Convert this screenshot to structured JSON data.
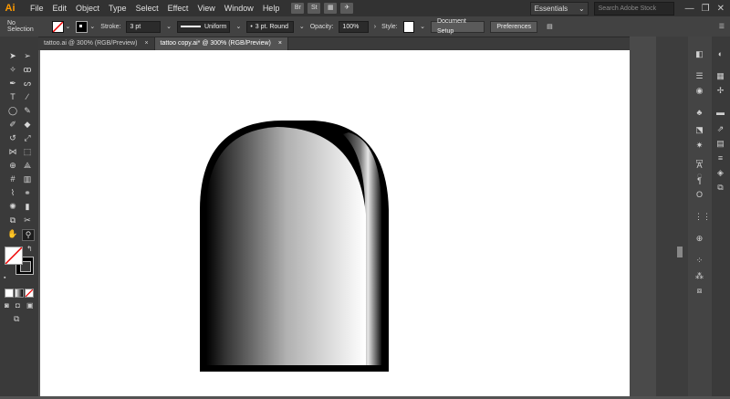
{
  "app": {
    "logo": "Ai"
  },
  "menu": [
    "File",
    "Edit",
    "Object",
    "Type",
    "Select",
    "Effect",
    "View",
    "Window",
    "Help"
  ],
  "app_icons": [
    "Br",
    "St"
  ],
  "workspace": "Essentials",
  "search_placeholder": "Search Adobe Stock",
  "control": {
    "selection": "No Selection",
    "stroke_label": "Stroke:",
    "stroke_value": "3 pt",
    "profile": "Uniform",
    "brush": "3 pt. Round",
    "opacity_label": "Opacity:",
    "opacity_value": "100%",
    "style_label": "Style:",
    "doc_setup": "Document Setup",
    "preferences": "Preferences"
  },
  "tabs": [
    {
      "label": "tattoo.ai @ 300% (RGB/Preview)",
      "close": "×"
    },
    {
      "label": "tattoo copy.ai* @ 300% (RGB/Preview)",
      "close": "×"
    }
  ],
  "window_controls": [
    "—",
    "❐",
    "✕"
  ],
  "tools": [
    "arrow-icon",
    "direct-select-icon",
    "magic-wand-icon",
    "lasso-icon",
    "pen-icon",
    "curvature-icon",
    "type-icon",
    "line-icon",
    "ellipse-icon",
    "paintbrush-icon",
    "shaper-icon",
    "eraser-icon",
    "rotate-icon",
    "scale-icon",
    "width-icon",
    "free-transform-icon",
    "shape-builder-icon",
    "perspective-icon",
    "mesh-icon",
    "gradient-icon",
    "eyedropper-icon",
    "blend-icon",
    "symbol-icon",
    "graph-icon",
    "artboard-icon",
    "slice-icon",
    "hand-icon",
    "zoom-icon"
  ],
  "colors": {
    "fill": "#ffffff",
    "stroke": "#000000",
    "accent": "#ff9a00"
  }
}
